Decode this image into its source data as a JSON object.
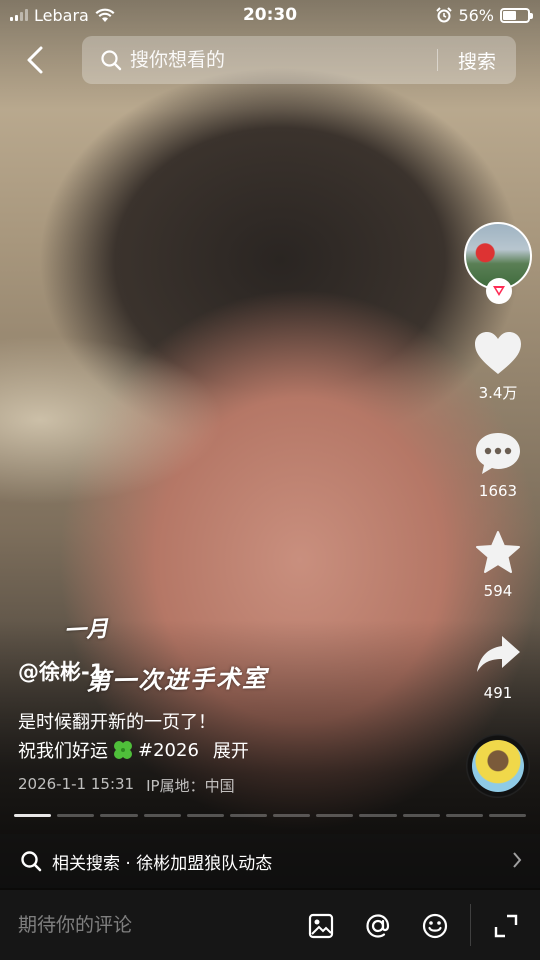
{
  "status_bar": {
    "carrier": "Lebara",
    "time": "20:30",
    "battery": "56%",
    "battery_level": 0.56
  },
  "search": {
    "placeholder": "搜你想看的",
    "button_label": "搜索"
  },
  "sidebar": {
    "like_count": "3.4万",
    "comment_count": "1663",
    "favorite_count": "594",
    "share_count": "491"
  },
  "overlay": {
    "line1": "一月",
    "line2": "第一次进手术室"
  },
  "post": {
    "author": "@徐彬-1",
    "caption_line1": "是时候翻开新的一页了！",
    "caption_line2_prefix": "祝我们好运",
    "hashtag": "#2026",
    "expand": "展开",
    "date": "2026-1-1 15:31",
    "ip_location": "IP属地：中国"
  },
  "progress": {
    "segments": 12,
    "active_index": 0
  },
  "related_search": {
    "text": "相关搜索 · 徐彬加盟狼队动态"
  },
  "comment_bar": {
    "placeholder": "期待你的评论"
  },
  "icons": [
    "back-icon",
    "search-icon",
    "heart-icon",
    "comment-icon",
    "star-icon",
    "share-icon",
    "image-icon",
    "at-icon",
    "emoji-icon",
    "fullscreen-icon",
    "chevron-right-icon",
    "clover-icon",
    "plus-badge-icon",
    "wifi-icon",
    "alarm-icon",
    "battery-icon"
  ]
}
